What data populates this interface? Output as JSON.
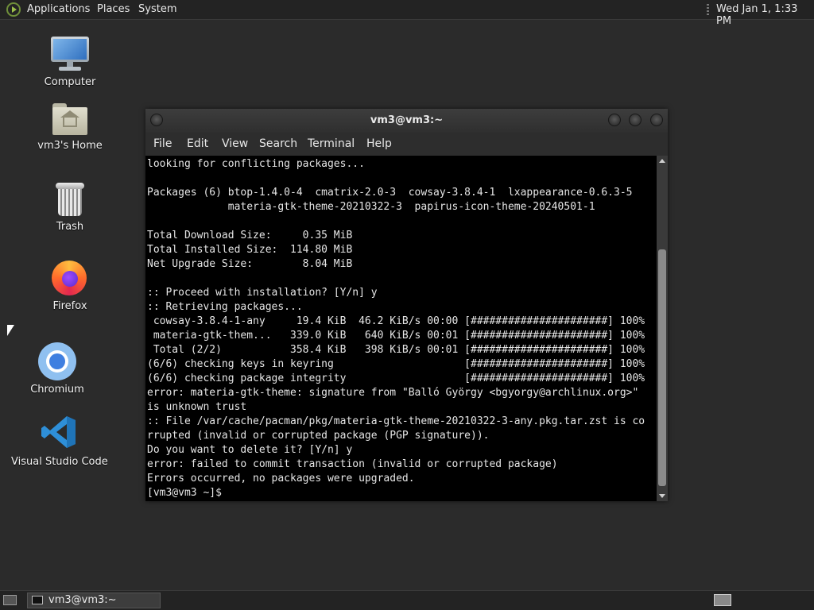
{
  "top_panel": {
    "menus": [
      "Applications",
      "Places",
      "System"
    ],
    "clock": "Wed Jan  1, 1:33 PM"
  },
  "desktop": {
    "icons": [
      {
        "label": "Computer",
        "icon": "computer-icon"
      },
      {
        "label": "vm3's Home",
        "icon": "home-folder-icon"
      },
      {
        "label": "Trash",
        "icon": "trash-icon"
      },
      {
        "label": "Firefox",
        "icon": "firefox-icon"
      },
      {
        "label": "Chromium",
        "icon": "chromium-icon"
      },
      {
        "label": "Visual Studio Code",
        "icon": "vscode-icon"
      }
    ]
  },
  "terminal": {
    "title": "vm3@vm3:~",
    "menu": [
      "File",
      "Edit",
      "View",
      "Search",
      "Terminal",
      "Help"
    ],
    "lines": [
      "looking for conflicting packages...",
      "",
      "Packages (6) btop-1.4.0-4  cmatrix-2.0-3  cowsay-3.8.4-1  lxappearance-0.6.3-5",
      "             materia-gtk-theme-20210322-3  papirus-icon-theme-20240501-1",
      "",
      "Total Download Size:     0.35 MiB",
      "Total Installed Size:  114.80 MiB",
      "Net Upgrade Size:        8.04 MiB",
      "",
      ":: Proceed with installation? [Y/n] y",
      ":: Retrieving packages...",
      " cowsay-3.8.4-1-any     19.4 KiB  46.2 KiB/s 00:00 [######################] 100%",
      " materia-gtk-them...   339.0 KiB   640 KiB/s 00:01 [######################] 100%",
      " Total (2/2)           358.4 KiB   398 KiB/s 00:01 [######################] 100%",
      "(6/6) checking keys in keyring                     [######################] 100%",
      "(6/6) checking package integrity                   [######################] 100%",
      "error: materia-gtk-theme: signature from \"Balló György <bgyorgy@archlinux.org>\"",
      "is unknown trust",
      ":: File /var/cache/pacman/pkg/materia-gtk-theme-20210322-3-any.pkg.tar.zst is co",
      "rrupted (invalid or corrupted package (PGP signature)).",
      "Do you want to delete it? [Y/n] y",
      "error: failed to commit transaction (invalid or corrupted package)",
      "Errors occurred, no packages were upgraded.",
      "[vm3@vm3 ~]$ "
    ]
  },
  "taskbar": {
    "tasks": [
      {
        "label": "vm3@vm3:~",
        "icon": "terminal-icon"
      }
    ]
  }
}
